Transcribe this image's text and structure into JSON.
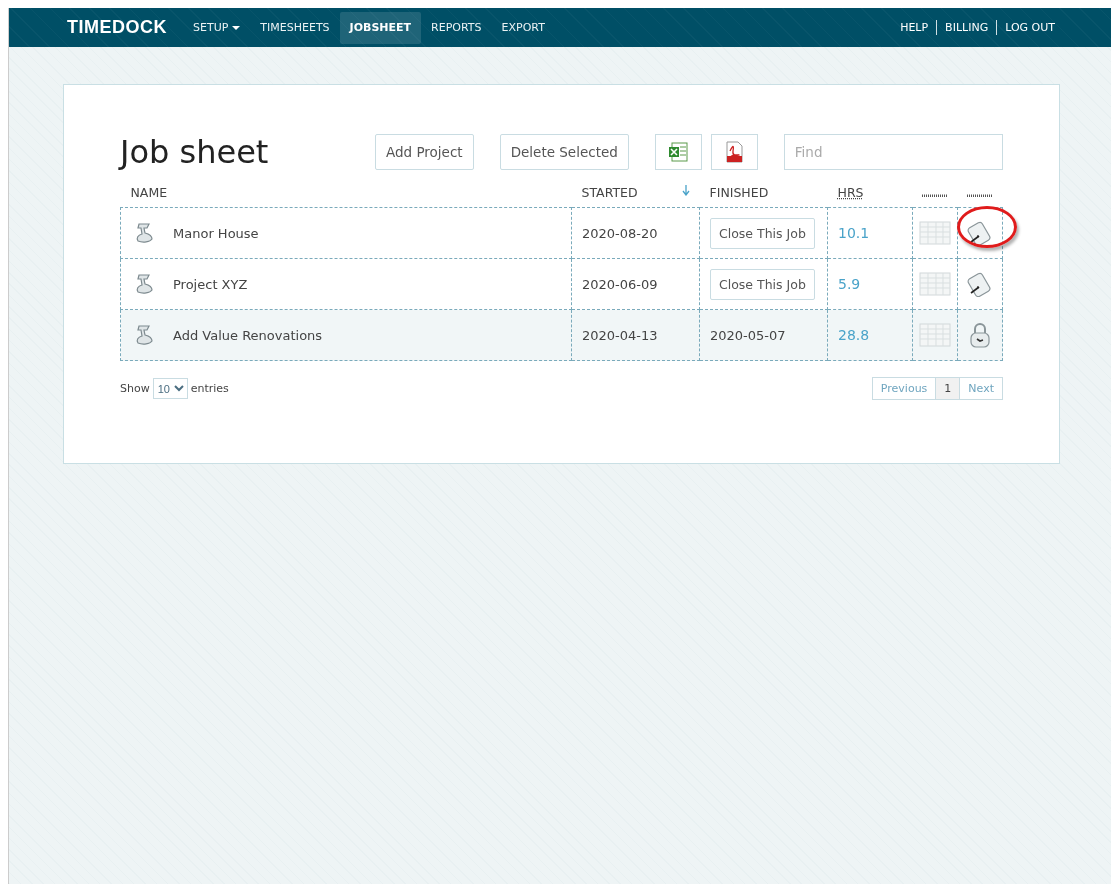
{
  "navbar": {
    "logo": "TIMEDOCK",
    "items": [
      {
        "label": "SETUP",
        "dropdown": true,
        "selected": false
      },
      {
        "label": "TIMESHEETS",
        "dropdown": false,
        "selected": false
      },
      {
        "label": "JOBSHEET",
        "dropdown": false,
        "selected": true
      },
      {
        "label": "REPORTS",
        "dropdown": false,
        "selected": false
      },
      {
        "label": "EXPORT",
        "dropdown": false,
        "selected": false
      }
    ],
    "right_links": [
      "HELP",
      "BILLING",
      "LOG OUT"
    ]
  },
  "page": {
    "title": "Job sheet",
    "buttons": [
      "Add Project",
      "Delete Selected"
    ],
    "search": {
      "placeholder": "Find"
    }
  },
  "table": {
    "columns": [
      {
        "label": "NAME",
        "sorted": false
      },
      {
        "label": "STARTED",
        "sorted": true
      },
      {
        "label": "FINISHED",
        "sorted": false
      },
      {
        "label": "HRS",
        "sorted": false
      }
    ],
    "rows": [
      {
        "name": "Manor House",
        "started": "2020-08-20",
        "finished": {
          "kind": "button",
          "text": "Close This Job"
        },
        "hrs": "10.1",
        "locked": false,
        "selected": false,
        "circled": true
      },
      {
        "name": "Project XYZ",
        "started": "2020-06-09",
        "finished": {
          "kind": "button",
          "text": "Close This Job"
        },
        "hrs": "5.9",
        "locked": false,
        "selected": false,
        "circled": false
      },
      {
        "name": "Add Value Renovations",
        "started": "2020-04-13",
        "finished": {
          "kind": "date",
          "text": "2020-05-07"
        },
        "hrs": "28.8",
        "locked": true,
        "selected": true,
        "circled": false
      }
    ]
  },
  "footer": {
    "show": "Show",
    "page_size": "10",
    "entries": "entries",
    "pagination": {
      "previous": "Previous",
      "pages": [
        {
          "label": "1",
          "selected": true
        }
      ],
      "next": "Next"
    }
  }
}
